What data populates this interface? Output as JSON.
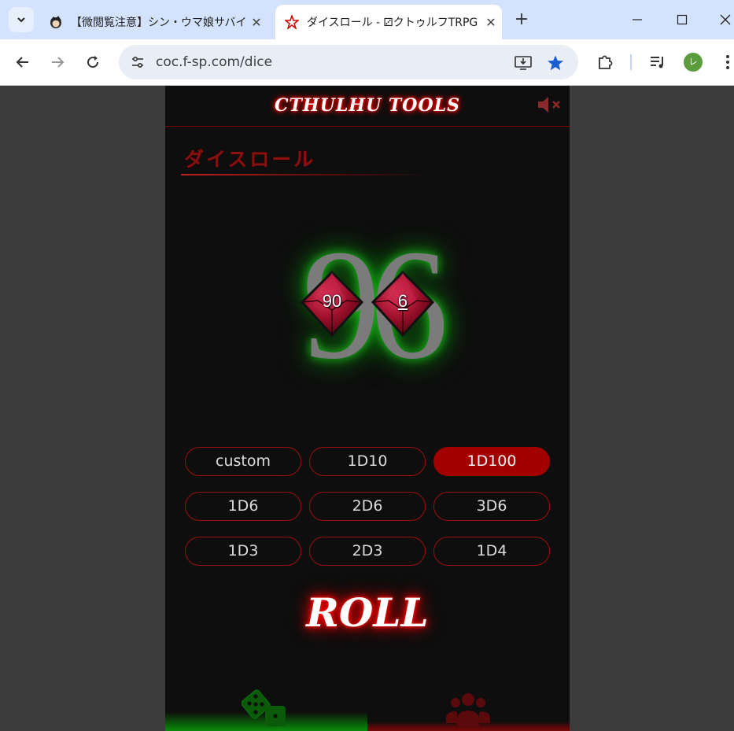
{
  "browser": {
    "tabs": [
      {
        "title": "【微閲覧注意】シン・ウマ娘サバイバル",
        "active": false
      },
      {
        "title": "ダイスロール - ⚂クトゥルフTRPG ツール",
        "active": true
      }
    ],
    "url": "coc.f-sp.com/dice",
    "profile_initial": "レ"
  },
  "site": {
    "logo_text": "CTHULHU TOOLS",
    "section_title": "ダイスロール",
    "result_number": "96",
    "dice": [
      {
        "label": "90",
        "underlined": false
      },
      {
        "label": "6",
        "underlined": true
      }
    ],
    "buttons": [
      {
        "label": "custom",
        "active": false
      },
      {
        "label": "1D10",
        "active": false
      },
      {
        "label": "1D100",
        "active": true
      },
      {
        "label": "1D6",
        "active": false
      },
      {
        "label": "2D6",
        "active": false
      },
      {
        "label": "3D6",
        "active": false
      },
      {
        "label": "1D3",
        "active": false
      },
      {
        "label": "2D3",
        "active": false
      },
      {
        "label": "1D4",
        "active": false
      }
    ],
    "roll_label": "ROLL"
  },
  "colors": {
    "accent_red": "#a30000",
    "border_red": "#9b1010",
    "glow_green": "#1fbf1f",
    "page_bg": "#0e0e0e"
  }
}
